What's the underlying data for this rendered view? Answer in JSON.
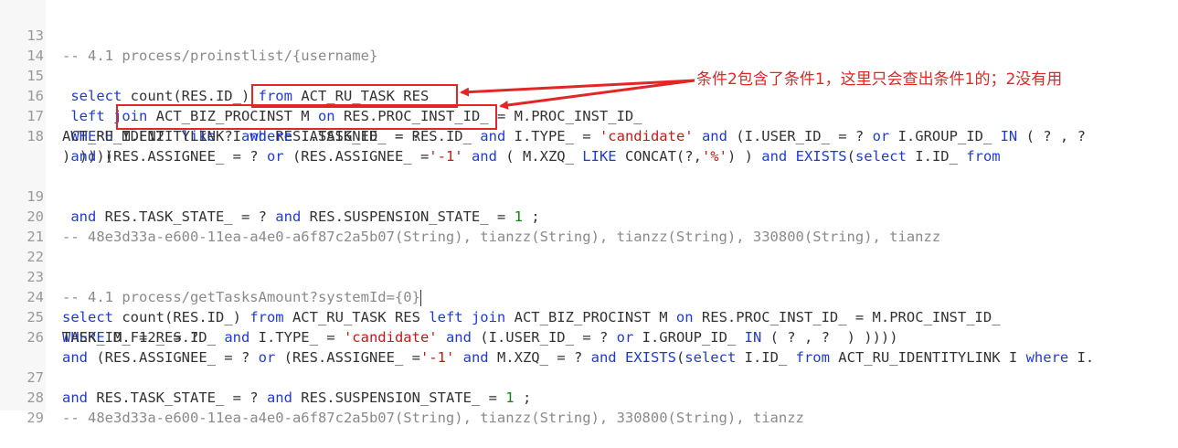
{
  "lines": [
    {
      "no": "13",
      "text": "-- 4.1 process/proinstlist/{username}"
    },
    {
      "no": "14"
    },
    {
      "no": "15",
      "p1": " select",
      "p2": " count(RES.ID_)",
      "p3": " from",
      "p4": " ACT_RU_TASK RES"
    },
    {
      "no": "16",
      "p1": " left join",
      "p2": " ACT_BIZ_PROCINST M",
      "p3": " on",
      "p4": " RES.PROC_INST_ID_ = M.PROC_INST_ID_"
    },
    {
      "no": "17",
      "p1": " WHERE",
      "p2": " M.F12  ",
      "p3": "like",
      "p4": " ? ",
      "p5": "and",
      "p6": " RES.ASSIGNEE  = ?"
    },
    {
      "no": "18",
      "a1": " and",
      "a2": " (RES.ASSIGNEE_ = ? ",
      "a3": "or",
      "a4": " (RES.ASSIGNEE_ =",
      "a5": "'-1'",
      "a6": " ",
      "a7": "and",
      "a8": " ( M.XZQ_ ",
      "a9": "LIKE",
      "a10": " CONCAT(?,",
      "a11": "'%'",
      "a12": ") ) ",
      "a13": "and",
      "a14": " ",
      "a15": "EXISTS",
      "a16": "(",
      "a17": "select",
      "a18": " I.ID_ ",
      "a19": "from",
      "b1": "ACT_RU_IDENTITYLINK I ",
      "b2": "where",
      "b3": " I.TASK_ID_ = RES.ID_ ",
      "b4": "and",
      "b5": " I.TYPE_ = ",
      "b6": "'candidate'",
      "b7": " ",
      "b8": "and",
      "b9": " (I.USER_ID_ = ? ",
      "b10": "or",
      "b11": " I.GROUP_ID_ ",
      "b12": "IN",
      "b13": " ( ? , ?",
      "c1": ") ))))"
    },
    {
      "no": "19",
      "p1": " and",
      "p2": " RES.TASK_STATE_ = ? ",
      "p3": "and",
      "p4": " RES.SUSPENSION_STATE_ = ",
      "p5": "1",
      "p6": " ;"
    },
    {
      "no": "20",
      "text": "-- 48e3d33a-e600-11ea-a4e0-a6f87c2a5b07(String), tianzz(String), tianzz(String), 330800(String), tianzz"
    },
    {
      "no": "21"
    },
    {
      "no": "22"
    },
    {
      "no": "23",
      "text": "-- 4.1 process/getTasksAmount?systemId={0}"
    },
    {
      "no": "24",
      "p1": "select",
      "p2": " count(RES.ID_) ",
      "p3": "from",
      "p4": " ACT_RU_TASK RES ",
      "p5": "left join",
      "p6": " ACT_BIZ_PROCINST M ",
      "p7": "on",
      "p8": " RES.PROC_INST_ID_ = M.PROC_INST_ID_"
    },
    {
      "no": "25",
      "p1": "WHERE",
      "p2": " M.F12_ = ?"
    },
    {
      "no": "26",
      "a1": "and",
      "a2": " (RES.ASSIGNEE_ = ? ",
      "a3": "or",
      "a4": " (RES.ASSIGNEE_ =",
      "a5": "'-1'",
      "a6": " ",
      "a7": "and",
      "a8": " M.XZQ_ = ? ",
      "a9": "and",
      "a10": " ",
      "a11": "EXISTS",
      "a12": "(",
      "a13": "select",
      "a14": " I.ID_ ",
      "a15": "from",
      "a16": " ACT_RU_IDENTITYLINK I ",
      "a17": "where",
      "a18": " I.",
      "b1": "TASK_ID_ = RES.ID_ ",
      "b2": "and",
      "b3": " I.TYPE_ = ",
      "b4": "'candidate'",
      "b5": " ",
      "b6": "and",
      "b7": " (I.USER_ID_ = ? ",
      "b8": "or",
      "b9": " I.GROUP_ID_ ",
      "b10": "IN",
      "b11": " ( ? , ?  ) ))))"
    },
    {
      "no": "27",
      "p1": "and",
      "p2": " RES.TASK_STATE_ = ? ",
      "p3": "and",
      "p4": " RES.SUSPENSION_STATE_ = ",
      "p5": "1",
      "p6": " ;"
    },
    {
      "no": "28",
      "text": "-- 48e3d33a-e600-11ea-a4e0-a6f87c2a5b07(String), tianzz(String), 330800(String), tianzz"
    },
    {
      "no": "29"
    }
  ],
  "annotation": {
    "note": "条件2包含了条件1，这里只会查出条件1的；2没有用"
  },
  "colors": {
    "keyword": "#1f3bd6",
    "string": "#c41a16",
    "number": "#0a8a0a",
    "comment": "#8a8a8a",
    "annotation": "#e32525"
  }
}
